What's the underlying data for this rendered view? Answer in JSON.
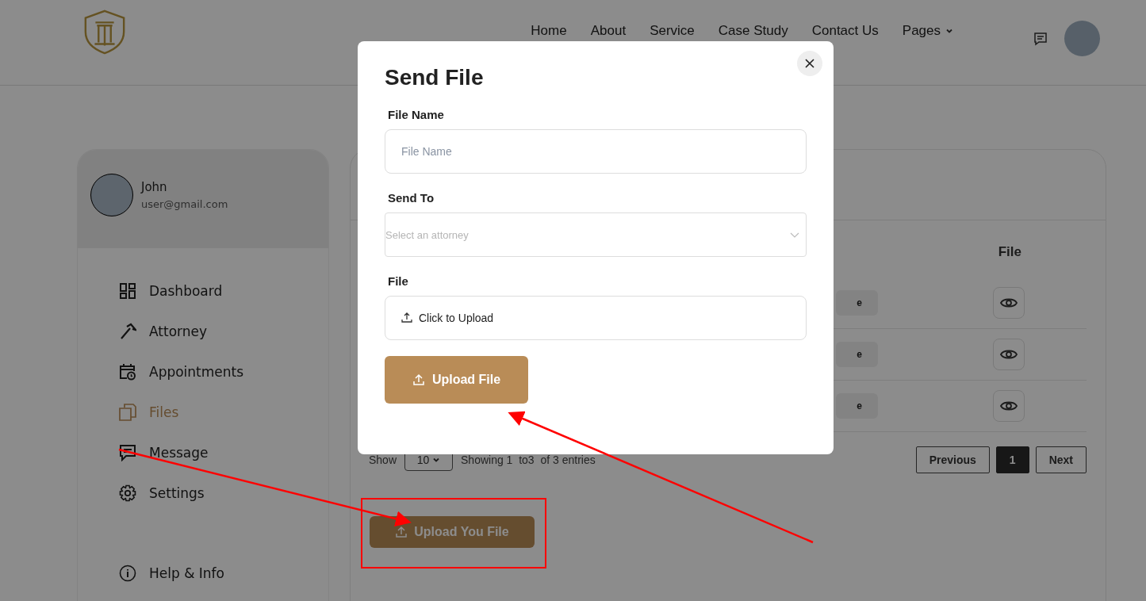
{
  "header": {
    "nav": [
      {
        "label": "Home",
        "dropdown": false
      },
      {
        "label": "About",
        "dropdown": false
      },
      {
        "label": "Service",
        "dropdown": false
      },
      {
        "label": "Case Study",
        "dropdown": false
      },
      {
        "label": "Contact Us",
        "dropdown": false
      },
      {
        "label": "Pages",
        "dropdown": true
      }
    ]
  },
  "sidebar": {
    "user": {
      "name": "John",
      "email": "user@gmail.com"
    },
    "items": [
      {
        "label": "Dashboard",
        "selected": false
      },
      {
        "label": "Attorney",
        "selected": false
      },
      {
        "label": "Appointments",
        "selected": false
      },
      {
        "label": "Files",
        "selected": true
      },
      {
        "label": "Message",
        "selected": false
      },
      {
        "label": "Settings",
        "selected": false
      }
    ],
    "help": {
      "label": "Help & Info"
    }
  },
  "table": {
    "columns": [
      "File"
    ],
    "rows": [
      {
        "status": "e"
      },
      {
        "status": "e"
      },
      {
        "status": "e"
      }
    ],
    "show_label": "Show",
    "page_size": "10",
    "info": "Showing 1  to3  of 3 entries",
    "pagination": [
      {
        "label": "Previous",
        "selected": false
      },
      {
        "label": "1",
        "selected": true
      },
      {
        "label": "Next",
        "selected": false
      }
    ]
  },
  "upload_button": "Upload You File",
  "modal": {
    "title": "Send File",
    "fields": [
      {
        "kind": "text",
        "label": "File Name",
        "placeholder": "File Name"
      },
      {
        "kind": "select",
        "label": "Send To",
        "placeholder": "Select an attorney"
      },
      {
        "kind": "upload",
        "label": "File",
        "text": "Click to Upload"
      }
    ],
    "submit": "Upload File"
  }
}
